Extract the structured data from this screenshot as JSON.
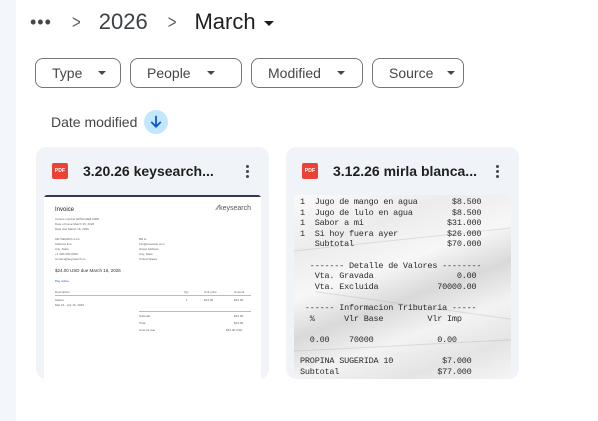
{
  "breadcrumb": {
    "more_icon": "more-horiz-icon",
    "year": "2026",
    "month": "March"
  },
  "filters": {
    "type": "Type",
    "people": "People",
    "modified": "Modified",
    "source": "Source"
  },
  "sort": {
    "label": "Date modified",
    "direction_icon": "arrow-downward-icon"
  },
  "files": [
    {
      "name": "3.20.26 keysearch...",
      "file_type": "PDF",
      "preview": {
        "title": "Invoice",
        "logo": "keysearch",
        "meta": [
          "Invoice number  EP9C12E8-0008",
          "Date of issue     March 16, 2026",
          "Date due          March 16, 2026"
        ],
        "from": [
          "KEYSEARCH LLC",
          "Address line",
          "City, State",
          "+1 000-000-0000",
          "contact@keysearch.co"
        ],
        "bill_to": [
          "Bill to",
          "info@example.com",
          "Street Address",
          "City, State",
          "United States"
        ],
        "due": "$24.00 USD due March 16, 2026",
        "pay_link": "Pay online",
        "columns": [
          "Description",
          "Qty",
          "Unit price",
          "Amount"
        ],
        "item": [
          "Starter",
          "1",
          "$24.00",
          "$24.00"
        ],
        "item_period": "Mar 16 - Apr 16, 2026",
        "totals": [
          [
            "Subtotal",
            "$24.00"
          ],
          [
            "Total",
            "$24.00"
          ],
          [
            "Amount due",
            "$24.00 USD"
          ]
        ]
      }
    },
    {
      "name": "3.12.26 mirla blanca...",
      "file_type": "PDF",
      "preview": {
        "lines": [
          "1  Jugo de mango en agua       $8.500",
          "1  Jugo de lulo en agua        $8.500",
          "1  Sabor a mi                 $31.000",
          "1  Si hoy fuera ayer          $26.000",
          "   Subtotal                   $70.000",
          "",
          "  ------- Detalle de Valores --------",
          "   Vta. Gravada                 0.00",
          "   Vta. Excluida            70000.00",
          "",
          " ------ Informacion Tributaria -----",
          "  %      Vlr Base         Vlr Imp",
          "",
          "  0.00    70000             0.00",
          "",
          "PROPINA SUGERIDA 10          $7.000",
          "Subtotal                    $77.000"
        ]
      }
    }
  ]
}
